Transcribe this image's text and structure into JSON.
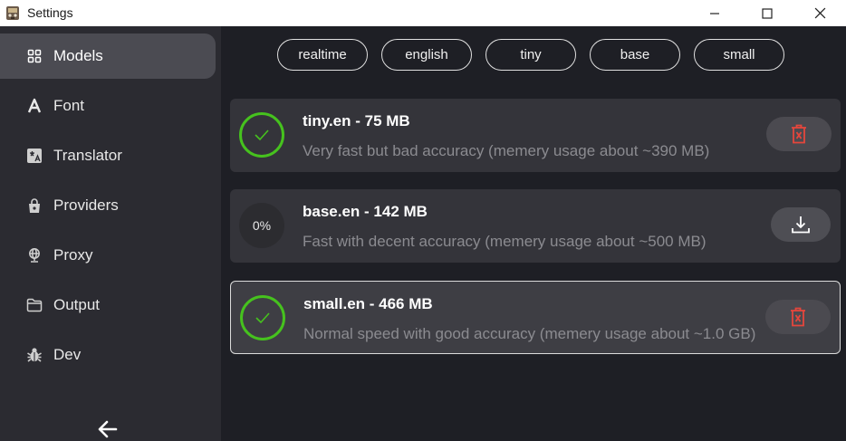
{
  "window": {
    "title": "Settings"
  },
  "sidebar": {
    "items": [
      {
        "label": "Models",
        "icon": "grid-icon",
        "active": true
      },
      {
        "label": "Font",
        "icon": "font-icon",
        "active": false
      },
      {
        "label": "Translator",
        "icon": "translate-icon",
        "active": false
      },
      {
        "label": "Providers",
        "icon": "shopping-bag-icon",
        "active": false
      },
      {
        "label": "Proxy",
        "icon": "globe-icon",
        "active": false
      },
      {
        "label": "Output",
        "icon": "folder-icon",
        "active": false
      },
      {
        "label": "Dev",
        "icon": "bug-icon",
        "active": false
      }
    ]
  },
  "filters": [
    "realtime",
    "english",
    "tiny",
    "base",
    "small"
  ],
  "models": [
    {
      "title": "tiny.en - 75 MB",
      "description": "Very fast but bad accuracy (memery usage about ~390 MB)",
      "downloaded": true,
      "selected": false
    },
    {
      "title": "base.en - 142 MB",
      "description": "Fast with decent accuracy (memery usage about ~500 MB)",
      "downloaded": false,
      "progress": "0%",
      "selected": false
    },
    {
      "title": "small.en - 466 MB",
      "description": "Normal speed with good accuracy (memery usage about ~1.0 GB)",
      "downloaded": true,
      "selected": true
    }
  ],
  "colors": {
    "accent_green": "#46c21e",
    "delete_red": "#e5463c"
  }
}
